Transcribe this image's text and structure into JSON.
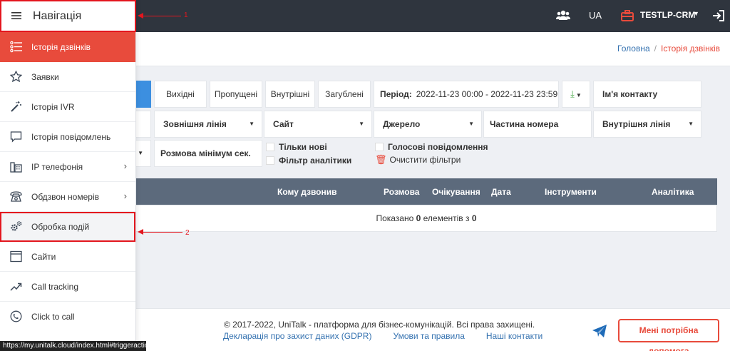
{
  "topbar": {
    "lang": "UA",
    "account": "TESTLP-CRM"
  },
  "breadcrumb": {
    "home": "Головна",
    "separator": "/",
    "current": "Історія дзвінків"
  },
  "filters": {
    "tabs": [
      "Вихідні",
      "Пропущені",
      "Внутрішні",
      "Загублені"
    ],
    "period_label": "Період:",
    "period_value": "2022-11-23 00:00 - 2022-11-23 23:59",
    "contact_name": "Ім'я контакту",
    "selects_row2": [
      "Зовнішня лінія",
      "Сайт",
      "Джерело",
      "Частина номера",
      "Внутрішня лінія"
    ],
    "min_duration": "Розмова мінімум сек.",
    "only_new": "Тільки нові",
    "voice_messages": "Голосові повідомлення",
    "analytics_filter": "Фільтр аналітики",
    "clear_filters": "Очистити фільтри"
  },
  "table": {
    "columns": [
      "Кому дзвонив",
      "Розмова",
      "Очікування",
      "Дата",
      "Інструменти",
      "Аналітика"
    ],
    "empty_prefix": "Показано",
    "empty_from": "0",
    "empty_mid": "елементів з",
    "empty_total": "0"
  },
  "footer": {
    "copyright": "© 2017-2022, UniTalk - платформа для бізнес-комунікацій. Всі права захищені.",
    "links": [
      "Декларація про захист даних (GDPR)",
      "Умови та правила",
      "Наші контакти"
    ],
    "help_button": "Мені потрібна допомога"
  },
  "sidebar": {
    "title": "Навігація",
    "items": [
      {
        "label": "Історія дзвінків",
        "icon": "list-icon"
      },
      {
        "label": "Заявки",
        "icon": "star-icon"
      },
      {
        "label": "Історія IVR",
        "icon": "magic-wand-icon"
      },
      {
        "label": "Історія повідомлень",
        "icon": "message-icon"
      },
      {
        "label": "IP телефонія",
        "icon": "phone-station-icon"
      },
      {
        "label": "Обдзвон номерів",
        "icon": "telephone-icon"
      },
      {
        "label": "Обробка подій",
        "icon": "gears-icon"
      },
      {
        "label": "Сайти",
        "icon": "browser-window-icon"
      },
      {
        "label": "Call tracking",
        "icon": "trend-icon"
      },
      {
        "label": "Click to call",
        "icon": "phone-circle-icon"
      }
    ]
  },
  "annotations": {
    "first": "1",
    "second": "2"
  },
  "status_url": "https://my.unitalk.cloud/index.html#triggeraction",
  "colors": {
    "accent": "#e84b3c",
    "topbar": "#2f353e",
    "table_header": "#5c6a7c",
    "active_tab": "#3c8fe0",
    "annotation": "#e3161e"
  }
}
